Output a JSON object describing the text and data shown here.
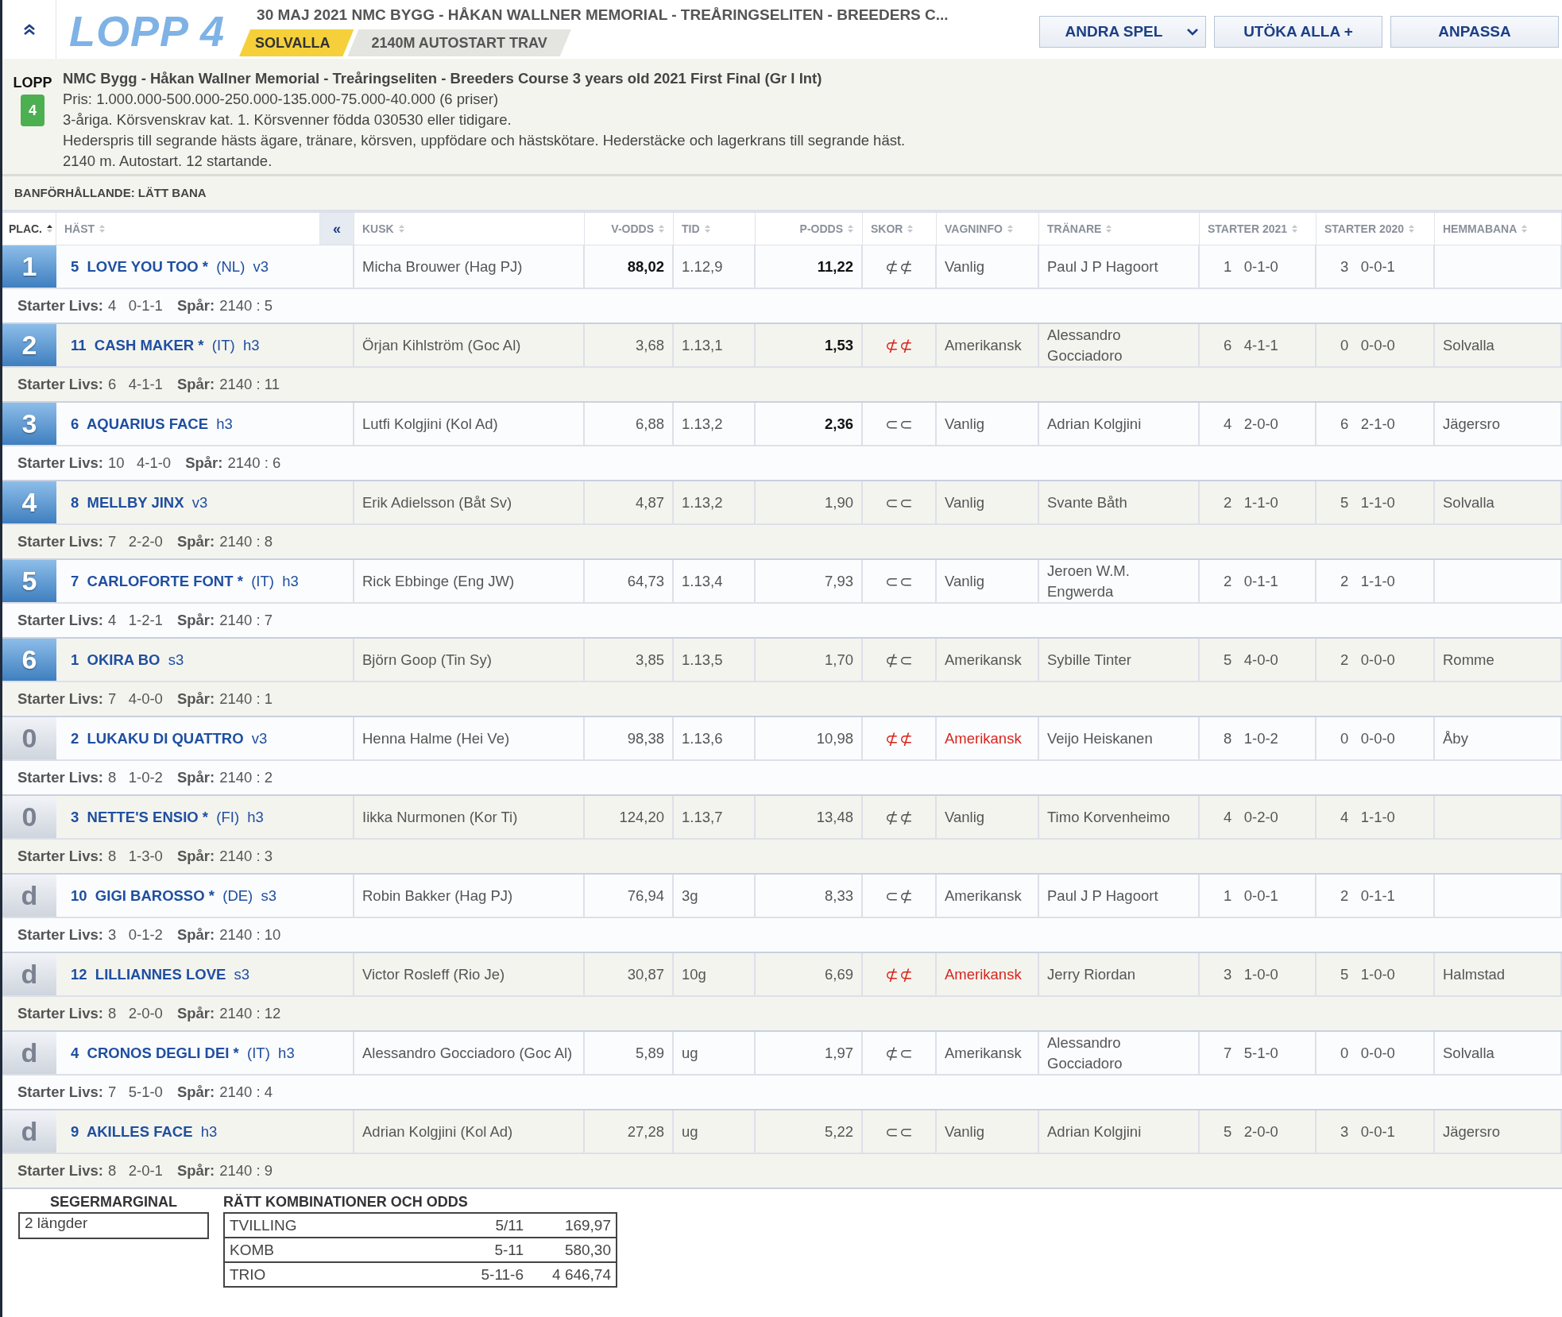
{
  "header": {
    "race_label": "LOPP 4",
    "title": "30 MAJ 2021 NMC BYGG - HÅKAN WALLNER MEMORIAL - TREÅRINGSELITEN - BREEDERS C...",
    "track": "SOLVALLA",
    "distance": "2140M AUTOSTART TRAV",
    "buttons": [
      {
        "label": "ANDRA SPEL",
        "dropdown": true
      },
      {
        "label": "UTÖKA ALLA +",
        "dropdown": false
      },
      {
        "label": "ANPASSA",
        "dropdown": false
      }
    ]
  },
  "info": {
    "lopp_label": "LOPP",
    "race_number": "4",
    "name": "NMC Bygg - Håkan Wallner Memorial - Treåringseliten - Breeders Course 3 years old 2021 First Final (Gr I Int)",
    "lines": [
      "Pris: 1.000.000-500.000-250.000-135.000-75.000-40.000 (6 priser)",
      "3-åriga. Körsvenskrav kat. 1. Körsvenner födda 030530 eller tidigare.",
      "Hederspris till segrande hästs ägare, tränare, körsven, uppfödare och hästskötare. Hederstäcke och lagerkrans till segrande häst.",
      "2140 m. Autostart. 12 startande."
    ]
  },
  "track_condition": "BANFÖRHÅLLANDE: LÄTT BANA",
  "table": {
    "collapse_button": "«",
    "columns": [
      {
        "label": "PLAC.",
        "sorted": true
      },
      {
        "label": "HÄST",
        "sorted": false
      },
      {
        "label": "KUSK",
        "sorted": false
      },
      {
        "label": "V-ODDS",
        "sorted": false
      },
      {
        "label": "TID",
        "sorted": false
      },
      {
        "label": "P-ODDS",
        "sorted": false
      },
      {
        "label": "SKOR",
        "sorted": false
      },
      {
        "label": "VAGNINFO",
        "sorted": false
      },
      {
        "label": "TRÄNARE",
        "sorted": false
      },
      {
        "label": "STARTER 2021",
        "sorted": false
      },
      {
        "label": "STARTER 2020",
        "sorted": false
      },
      {
        "label": "HEMMABANA",
        "sorted": false
      }
    ],
    "rows": [
      {
        "place": "1",
        "placed": true,
        "horse": {
          "number": "5",
          "name": "LOVE YOU TOO",
          "mark": "*",
          "country": "(NL)",
          "age": "v3"
        },
        "driver": "Micha Brouwer (Hag PJ)",
        "v_odds": "88,02",
        "v_odds_bold": true,
        "time": "1.12,9",
        "p_odds": "11,22",
        "p_odds_bold": true,
        "shoes": "⊄⊄",
        "shoes_alert": false,
        "cart": "Vanlig",
        "cart_alert": false,
        "trainer": "Paul J P Hagoort",
        "starts_2021": {
          "count": "1",
          "record": "0-1-0"
        },
        "starts_2020": {
          "count": "3",
          "record": "0-0-1"
        },
        "career_label": "Starter Livs:",
        "career": {
          "count": "4",
          "record": "0-1-1"
        },
        "post_label": "Spår:",
        "post": "2140 : 5"
      },
      {
        "place": "2",
        "placed": true,
        "horse": {
          "number": "11",
          "name": "CASH MAKER",
          "mark": "*",
          "country": "(IT)",
          "age": "h3"
        },
        "driver": "Örjan Kihlström (Goc Al)",
        "v_odds": "3,68",
        "v_odds_bold": false,
        "time": "1.13,1",
        "p_odds": "1,53",
        "p_odds_bold": true,
        "shoes": "⊄⊄",
        "shoes_alert": true,
        "cart": "Amerikansk",
        "cart_alert": false,
        "trainer": "Alessandro Gocciadoro",
        "starts_2021": {
          "count": "6",
          "record": "4-1-1"
        },
        "starts_2020": {
          "count": "0",
          "record": "0-0-0"
        },
        "home_track": "Solvalla",
        "career_label": "Starter Livs:",
        "career": {
          "count": "6",
          "record": "4-1-1"
        },
        "post_label": "Spår:",
        "post": "2140 : 11"
      },
      {
        "place": "3",
        "placed": true,
        "horse": {
          "number": "6",
          "name": "AQUARIUS FACE",
          "age": "h3"
        },
        "driver": "Lutfi Kolgjini (Kol Ad)",
        "v_odds": "6,88",
        "v_odds_bold": false,
        "time": "1.13,2",
        "p_odds": "2,36",
        "p_odds_bold": true,
        "shoes": "⊂⊂",
        "shoes_alert": false,
        "cart": "Vanlig",
        "cart_alert": false,
        "trainer": "Adrian Kolgjini",
        "starts_2021": {
          "count": "4",
          "record": "2-0-0"
        },
        "starts_2020": {
          "count": "6",
          "record": "2-1-0"
        },
        "home_track": "Jägersro",
        "career_label": "Starter Livs:",
        "career": {
          "count": "10",
          "record": "4-1-0"
        },
        "post_label": "Spår:",
        "post": "2140 : 6"
      },
      {
        "place": "4",
        "placed": true,
        "horse": {
          "number": "8",
          "name": "MELLBY JINX",
          "age": "v3"
        },
        "driver": "Erik Adielsson (Båt Sv)",
        "v_odds": "4,87",
        "v_odds_bold": false,
        "time": "1.13,2",
        "p_odds": "1,90",
        "p_odds_bold": false,
        "shoes": "⊂⊂",
        "shoes_alert": false,
        "cart": "Vanlig",
        "cart_alert": false,
        "trainer": "Svante Båth",
        "starts_2021": {
          "count": "2",
          "record": "1-1-0"
        },
        "starts_2020": {
          "count": "5",
          "record": "1-1-0"
        },
        "home_track": "Solvalla",
        "career_label": "Starter Livs:",
        "career": {
          "count": "7",
          "record": "2-2-0"
        },
        "post_label": "Spår:",
        "post": "2140 : 8"
      },
      {
        "place": "5",
        "placed": true,
        "horse": {
          "number": "7",
          "name": "CARLOFORTE FONT",
          "mark": "*",
          "country": "(IT)",
          "age": "h3"
        },
        "driver": "Rick Ebbinge (Eng JW)",
        "v_odds": "64,73",
        "v_odds_bold": false,
        "time": "1.13,4",
        "p_odds": "7,93",
        "p_odds_bold": false,
        "shoes": "⊂⊂",
        "shoes_alert": false,
        "cart": "Vanlig",
        "cart_alert": false,
        "trainer": "Jeroen W.M. Engwerda",
        "starts_2021": {
          "count": "2",
          "record": "0-1-1"
        },
        "starts_2020": {
          "count": "2",
          "record": "1-1-0"
        },
        "career_label": "Starter Livs:",
        "career": {
          "count": "4",
          "record": "1-2-1"
        },
        "post_label": "Spår:",
        "post": "2140 : 7"
      },
      {
        "place": "6",
        "placed": true,
        "horse": {
          "number": "1",
          "name": "OKIRA BO",
          "age": "s3"
        },
        "driver": "Björn Goop (Tin Sy)",
        "v_odds": "3,85",
        "v_odds_bold": false,
        "time": "1.13,5",
        "p_odds": "1,70",
        "p_odds_bold": false,
        "shoes": "⊄⊂",
        "shoes_alert": false,
        "cart": "Amerikansk",
        "cart_alert": false,
        "trainer": "Sybille Tinter",
        "starts_2021": {
          "count": "5",
          "record": "4-0-0"
        },
        "starts_2020": {
          "count": "2",
          "record": "0-0-0"
        },
        "home_track": "Romme",
        "career_label": "Starter Livs:",
        "career": {
          "count": "7",
          "record": "4-0-0"
        },
        "post_label": "Spår:",
        "post": "2140 : 1"
      },
      {
        "place": "0",
        "placed": false,
        "horse": {
          "number": "2",
          "name": "LUKAKU DI QUATTRO",
          "age": "v3"
        },
        "driver": "Henna Halme (Hei Ve)",
        "v_odds": "98,38",
        "v_odds_bold": false,
        "time": "1.13,6",
        "p_odds": "10,98",
        "p_odds_bold": false,
        "shoes": "⊄⊄",
        "shoes_alert": true,
        "cart": "Amerikansk",
        "cart_alert": true,
        "trainer": "Veijo Heiskanen",
        "starts_2021": {
          "count": "8",
          "record": "1-0-2"
        },
        "starts_2020": {
          "count": "0",
          "record": "0-0-0"
        },
        "home_track": "Åby",
        "career_label": "Starter Livs:",
        "career": {
          "count": "8",
          "record": "1-0-2"
        },
        "post_label": "Spår:",
        "post": "2140 : 2"
      },
      {
        "place": "0",
        "placed": false,
        "horse": {
          "number": "3",
          "name": "NETTE'S ENSIO",
          "mark": "*",
          "country": "(FI)",
          "age": "h3"
        },
        "driver": "Iikka Nurmonen (Kor Ti)",
        "v_odds": "124,20",
        "v_odds_bold": false,
        "time": "1.13,7",
        "p_odds": "13,48",
        "p_odds_bold": false,
        "shoes": "⊄⊄",
        "shoes_alert": false,
        "cart": "Vanlig",
        "cart_alert": false,
        "trainer": "Timo Korvenheimo",
        "starts_2021": {
          "count": "4",
          "record": "0-2-0"
        },
        "starts_2020": {
          "count": "4",
          "record": "1-1-0"
        },
        "career_label": "Starter Livs:",
        "career": {
          "count": "8",
          "record": "1-3-0"
        },
        "post_label": "Spår:",
        "post": "2140 : 3"
      },
      {
        "place": "d",
        "placed": false,
        "horse": {
          "number": "10",
          "name": "GIGI BAROSSO",
          "mark": "*",
          "country": "(DE)",
          "age": "s3"
        },
        "driver": "Robin Bakker (Hag PJ)",
        "v_odds": "76,94",
        "v_odds_bold": false,
        "time": "3g",
        "p_odds": "8,33",
        "p_odds_bold": false,
        "shoes": "⊂⊄",
        "shoes_alert": false,
        "cart": "Amerikansk",
        "cart_alert": false,
        "trainer": "Paul J P Hagoort",
        "starts_2021": {
          "count": "1",
          "record": "0-0-1"
        },
        "starts_2020": {
          "count": "2",
          "record": "0-1-1"
        },
        "career_label": "Starter Livs:",
        "career": {
          "count": "3",
          "record": "0-1-2"
        },
        "post_label": "Spår:",
        "post": "2140 : 10"
      },
      {
        "place": "d",
        "placed": false,
        "horse": {
          "number": "12",
          "name": "LILLIANNES LOVE",
          "age": "s3"
        },
        "driver": "Victor Rosleff (Rio Je)",
        "v_odds": "30,87",
        "v_odds_bold": false,
        "time": "10g",
        "p_odds": "6,69",
        "p_odds_bold": false,
        "shoes": "⊄⊄",
        "shoes_alert": true,
        "cart": "Amerikansk",
        "cart_alert": true,
        "trainer": "Jerry Riordan",
        "starts_2021": {
          "count": "3",
          "record": "1-0-0"
        },
        "starts_2020": {
          "count": "5",
          "record": "1-0-0"
        },
        "home_track": "Halmstad",
        "career_label": "Starter Livs:",
        "career": {
          "count": "8",
          "record": "2-0-0"
        },
        "post_label": "Spår:",
        "post": "2140 : 12"
      },
      {
        "place": "d",
        "placed": false,
        "horse": {
          "number": "4",
          "name": "CRONOS DEGLI DEI",
          "mark": "*",
          "country": "(IT)",
          "age": "h3"
        },
        "driver": "Alessandro Gocciadoro (Goc Al)",
        "v_odds": "5,89",
        "v_odds_bold": false,
        "time": "ug",
        "p_odds": "1,97",
        "p_odds_bold": false,
        "shoes": "⊄⊂",
        "shoes_alert": false,
        "cart": "Amerikansk",
        "cart_alert": false,
        "trainer": "Alessandro Gocciadoro",
        "starts_2021": {
          "count": "7",
          "record": "5-1-0"
        },
        "starts_2020": {
          "count": "0",
          "record": "0-0-0"
        },
        "home_track": "Solvalla",
        "career_label": "Starter Livs:",
        "career": {
          "count": "7",
          "record": "5-1-0"
        },
        "post_label": "Spår:",
        "post": "2140 : 4"
      },
      {
        "place": "d",
        "placed": false,
        "horse": {
          "number": "9",
          "name": "AKILLES FACE",
          "age": "h3"
        },
        "driver": "Adrian Kolgjini (Kol Ad)",
        "v_odds": "27,28",
        "v_odds_bold": false,
        "time": "ug",
        "p_odds": "5,22",
        "p_odds_bold": false,
        "shoes": "⊂⊂",
        "shoes_alert": false,
        "cart": "Vanlig",
        "cart_alert": false,
        "trainer": "Adrian Kolgjini",
        "starts_2021": {
          "count": "5",
          "record": "2-0-0"
        },
        "starts_2020": {
          "count": "3",
          "record": "0-0-1"
        },
        "home_track": "Jägersro",
        "career_label": "Starter Livs:",
        "career": {
          "count": "8",
          "record": "2-0-1"
        },
        "post_label": "Spår:",
        "post": "2140 : 9"
      }
    ]
  },
  "footer": {
    "margin_label": "SEGERMARGINAL",
    "margin": "2 längder",
    "combos_title": "RÄTT KOMBINATIONER OCH ODDS",
    "combos": [
      {
        "name": "TVILLING",
        "combination": "5/11",
        "odds": "169,97"
      },
      {
        "name": "KOMB",
        "combination": "5-11",
        "odds": "580,30"
      },
      {
        "name": "TRIO",
        "combination": "5-11-6",
        "odds": "4 646,74"
      }
    ]
  }
}
